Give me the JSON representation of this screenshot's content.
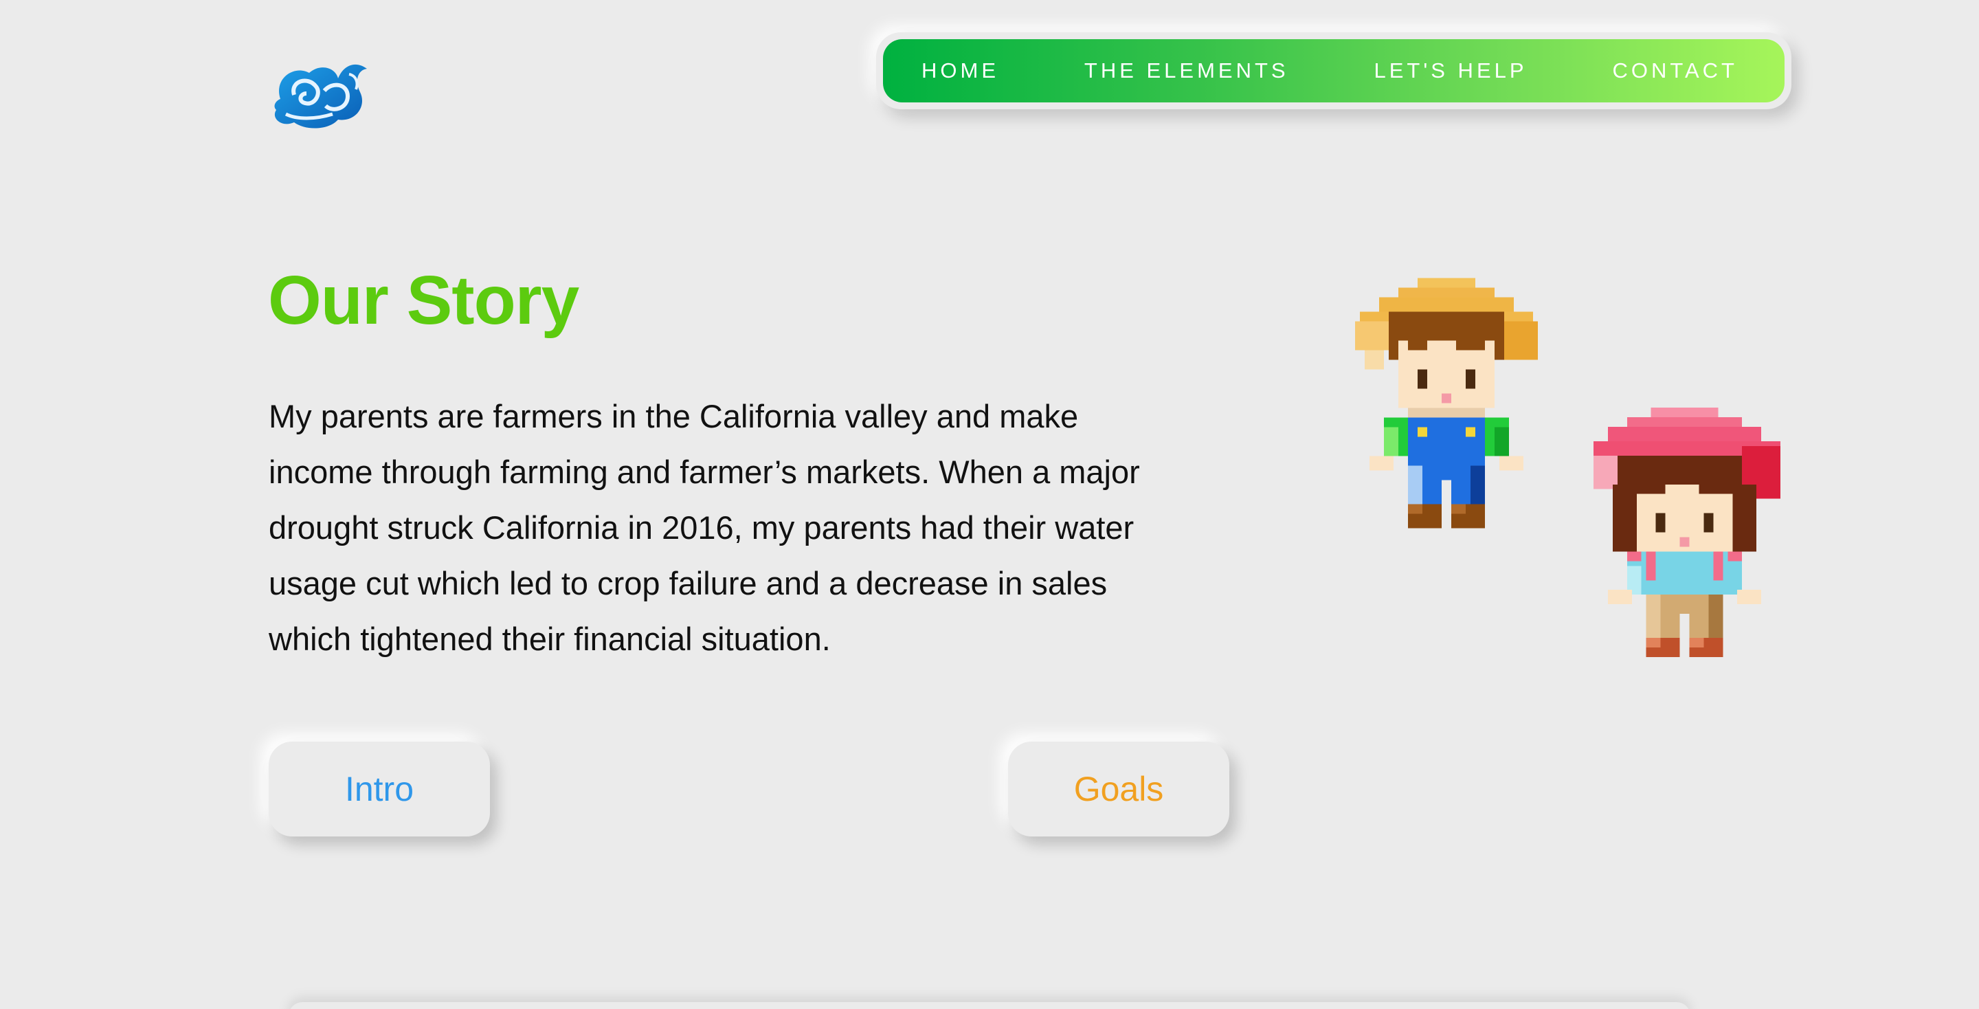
{
  "nav": {
    "items": [
      {
        "label": "HOME"
      },
      {
        "label": "THE ELEMENTS"
      },
      {
        "label": "LET'S HELP"
      },
      {
        "label": "CONTACT"
      }
    ],
    "gradient_start": "#00b140",
    "gradient_end": "#a6f55a"
  },
  "logo": {
    "icon": "water-swirl-logo-icon"
  },
  "main": {
    "title": "Our Story",
    "title_color": "#5ccb0f",
    "story_lines": [
      "My parents are farmers in the California valley and make",
      "income through farming and farmer’s markets. When a major",
      "drought struck California in 2016, my parents had their water",
      "usage cut which led to crop failure and a decrease in sales",
      "which tightened their financial situation."
    ]
  },
  "buttons": {
    "intro_label": "Intro",
    "intro_color": "#2f97ea",
    "goals_label": "Goals",
    "goals_color": "#f1a020"
  },
  "illustrations": {
    "farmer_boy": "pixel-farmer-boy-icon",
    "farmer_girl": "pixel-farmer-girl-icon"
  }
}
